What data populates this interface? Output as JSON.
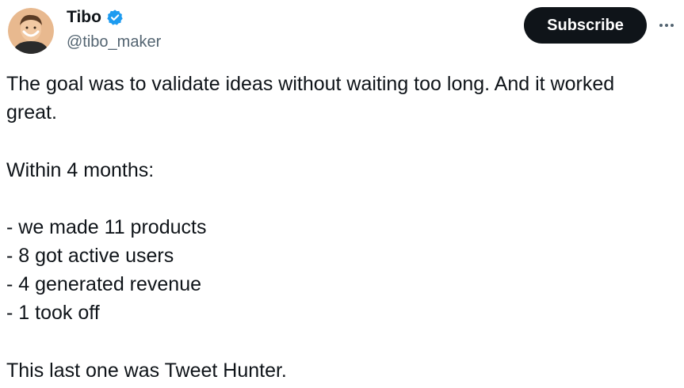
{
  "author": {
    "display_name": "Tibo",
    "handle": "@tibo_maker",
    "verified_badge_color": "#1d9bf0"
  },
  "actions": {
    "subscribe_label": "Subscribe",
    "more_icon": "ellipsis-icon"
  },
  "tweet": {
    "line1": "The goal was to validate ideas without waiting too long. And it worked",
    "line2": "great.",
    "line3": "Within 4 months:",
    "line4": "- we made 11 products",
    "line5": "- 8 got active users",
    "line6": "- 4 generated revenue",
    "line7": "- 1 took off",
    "line8": "This last one was Tweet Hunter."
  }
}
